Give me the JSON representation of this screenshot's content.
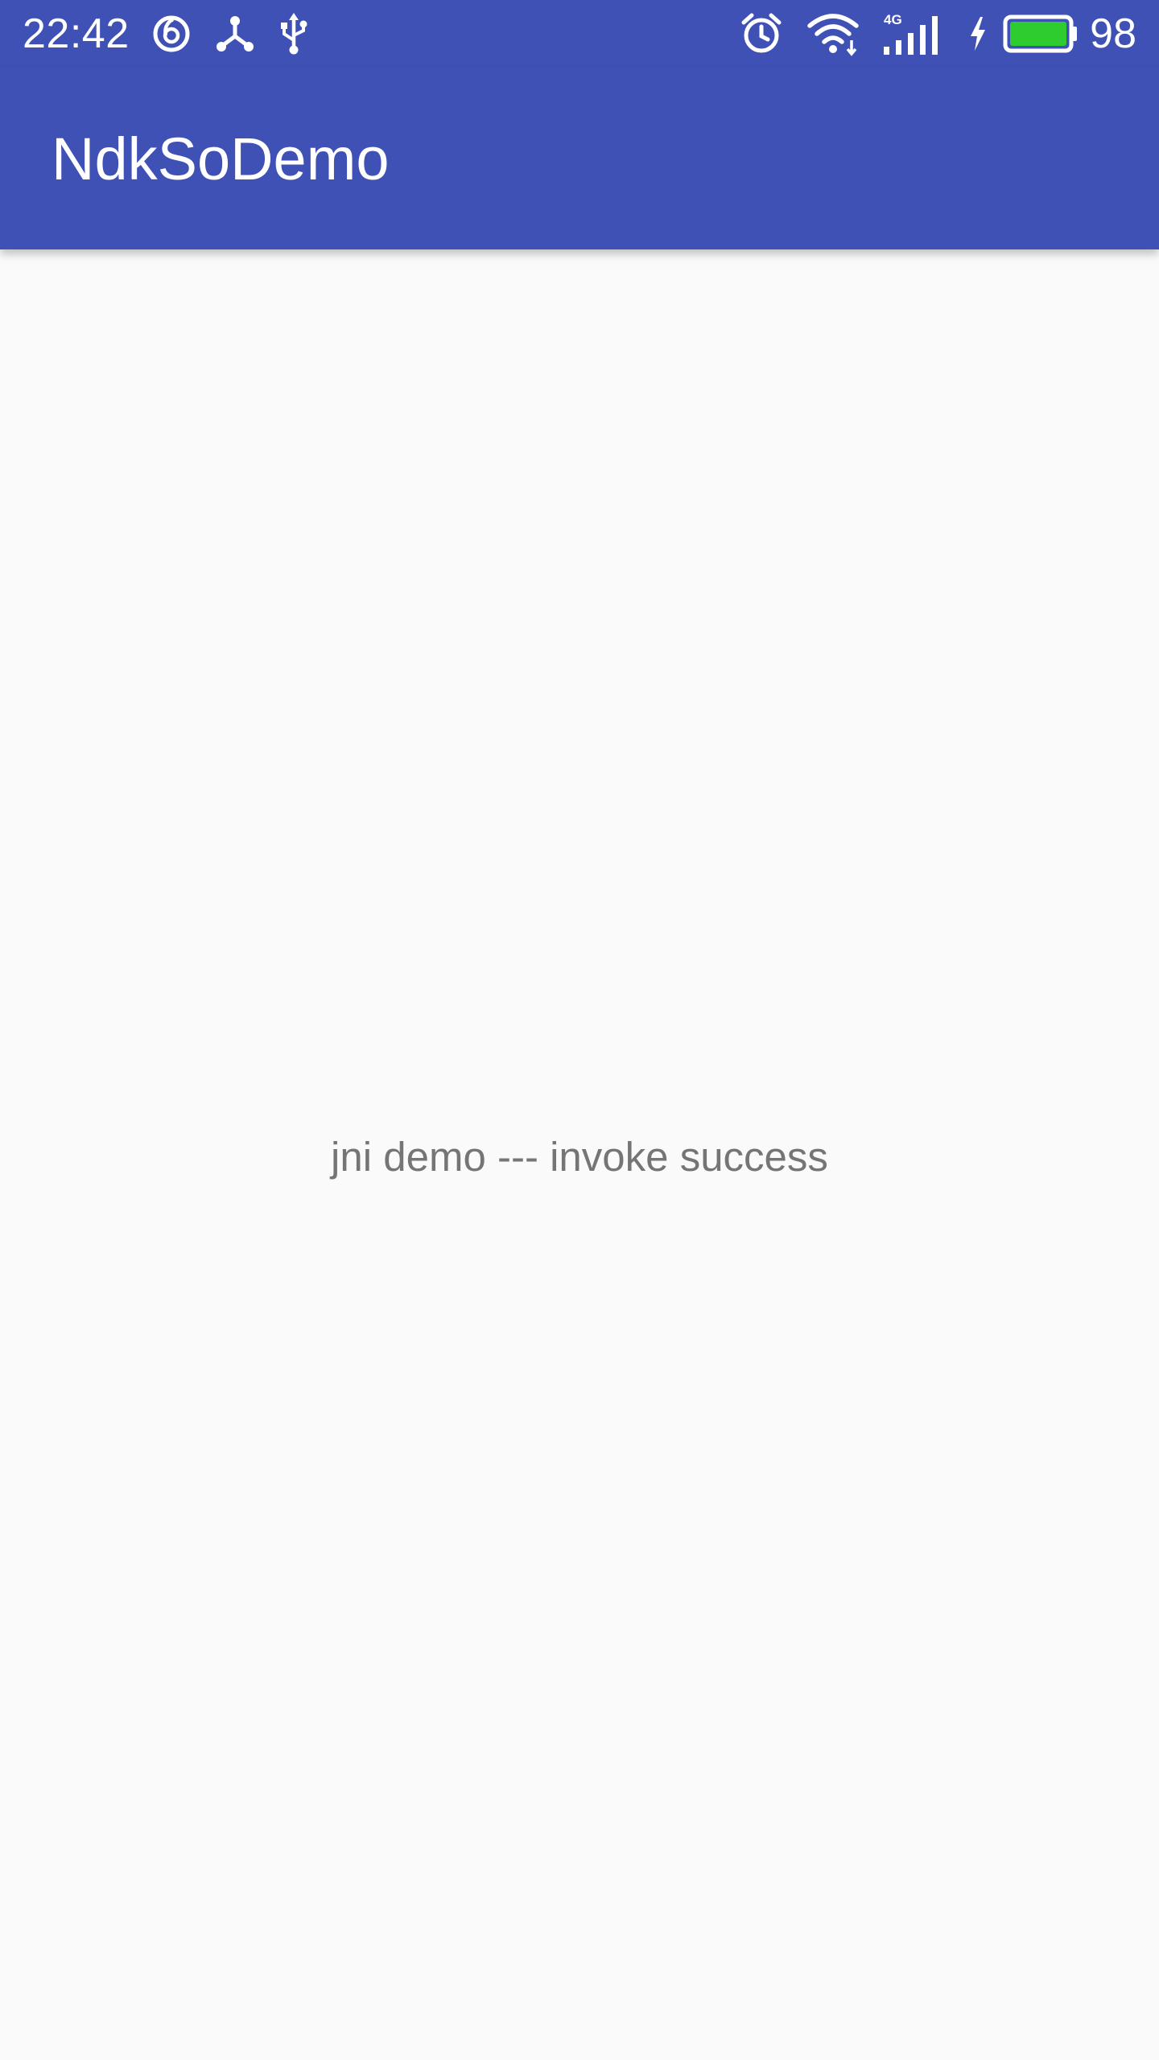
{
  "status_bar": {
    "time": "22:42",
    "left_icons": [
      "netease-music-icon",
      "share-network-icon",
      "usb-icon"
    ],
    "right_icons": [
      "alarm-icon",
      "wifi-icon",
      "signal-4g-icon",
      "charging-icon",
      "battery-icon"
    ],
    "network_type": "4G",
    "battery_percent": "98",
    "battery_color": "#2ecc2e",
    "background_color": "#3f51b5"
  },
  "app_bar": {
    "title": "NdkSoDemo",
    "background_color": "#3f51b5"
  },
  "main": {
    "message": "jni demo --- invoke success"
  }
}
